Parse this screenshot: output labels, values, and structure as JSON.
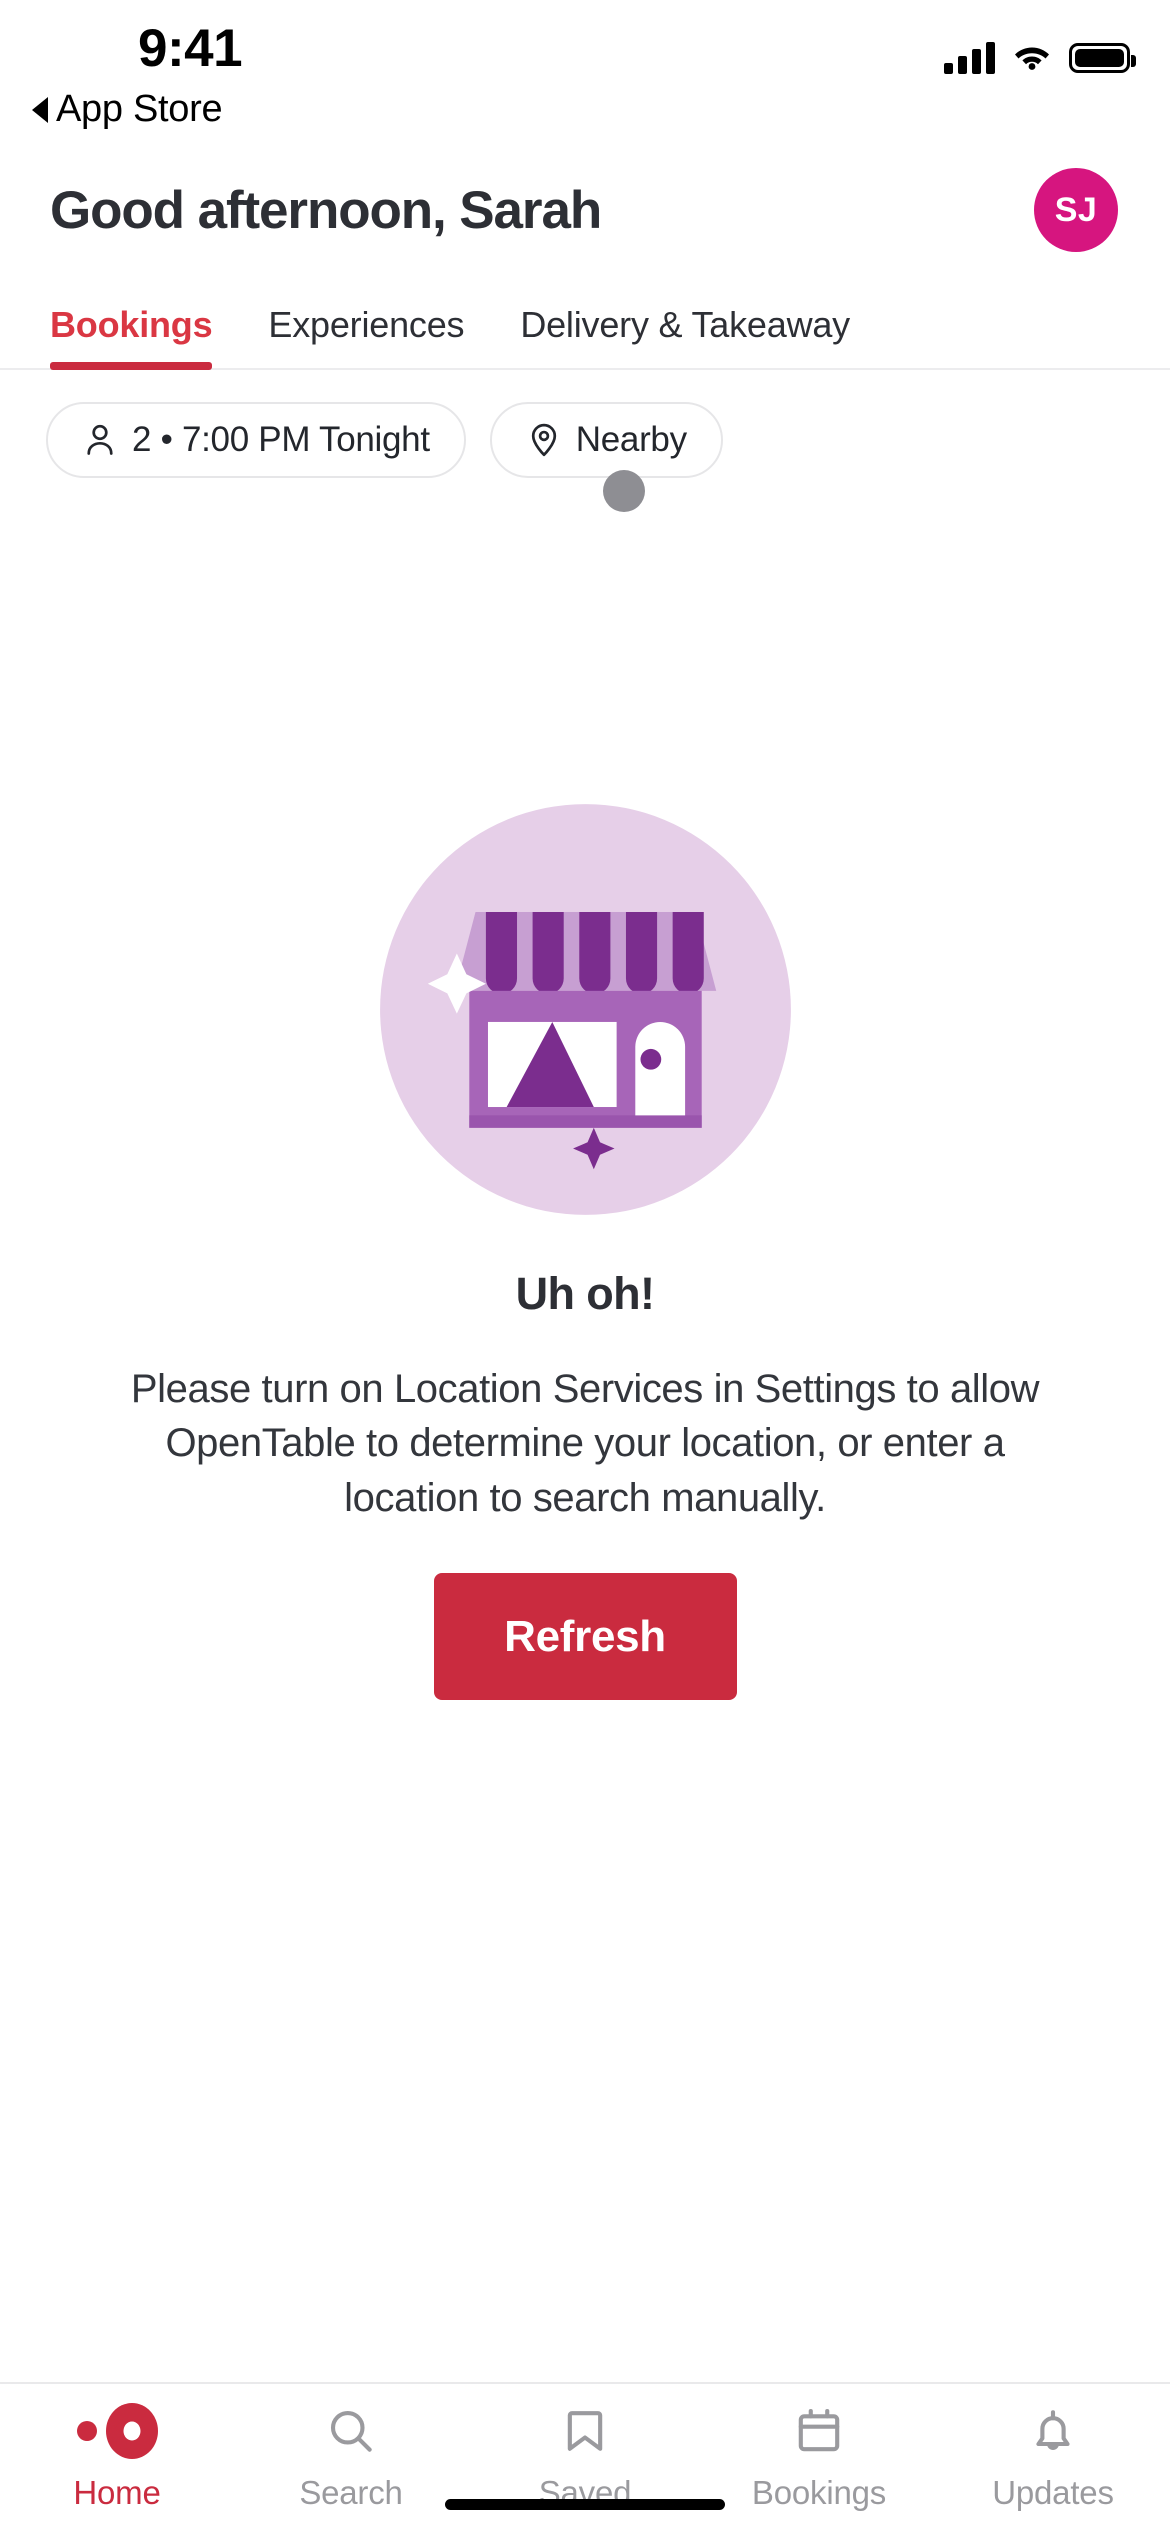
{
  "status_bar": {
    "time": "9:41",
    "back_label": "App Store",
    "signal_icon": "cellular-signal-icon",
    "wifi_icon": "wifi-icon",
    "battery_icon": "battery-icon"
  },
  "header": {
    "greeting": "Good afternoon, Sarah",
    "avatar_initials": "SJ",
    "avatar_color": "#d6157f"
  },
  "tabs": {
    "items": [
      {
        "label": "Bookings",
        "active": true
      },
      {
        "label": "Experiences",
        "active": false
      },
      {
        "label": "Delivery & Takeaway",
        "active": false
      }
    ],
    "active_color": "#ca2b3f"
  },
  "filters": {
    "party_time": "2 • 7:00 PM Tonight",
    "party_icon": "person-icon",
    "location": "Nearby",
    "location_icon": "location-pin-icon",
    "cursor_indicator": "touch-cursor-dot"
  },
  "empty_state": {
    "illustration": "storefront-illustration",
    "title": "Uh oh!",
    "message": "Please turn on Location Services in Settings to allow OpenTable to determine your location, or enter a location to search manually.",
    "button_label": "Refresh",
    "button_color": "#ca2b3f",
    "illustration_colors": {
      "circle": "#e6cfe8",
      "awning_dark": "#7b2d8e",
      "awning_light": "#c79fd2",
      "building": "#a765b8"
    }
  },
  "bottom_nav": {
    "items": [
      {
        "label": "Home",
        "icon": "opentable-logo-icon",
        "active": true
      },
      {
        "label": "Search",
        "icon": "search-icon",
        "active": false
      },
      {
        "label": "Saved",
        "icon": "bookmark-icon",
        "active": false
      },
      {
        "label": "Bookings",
        "icon": "calendar-icon",
        "active": false
      },
      {
        "label": "Updates",
        "icon": "bell-icon",
        "active": false
      }
    ],
    "active_color": "#ca2b3f",
    "inactive_color": "#9a9a9e"
  }
}
